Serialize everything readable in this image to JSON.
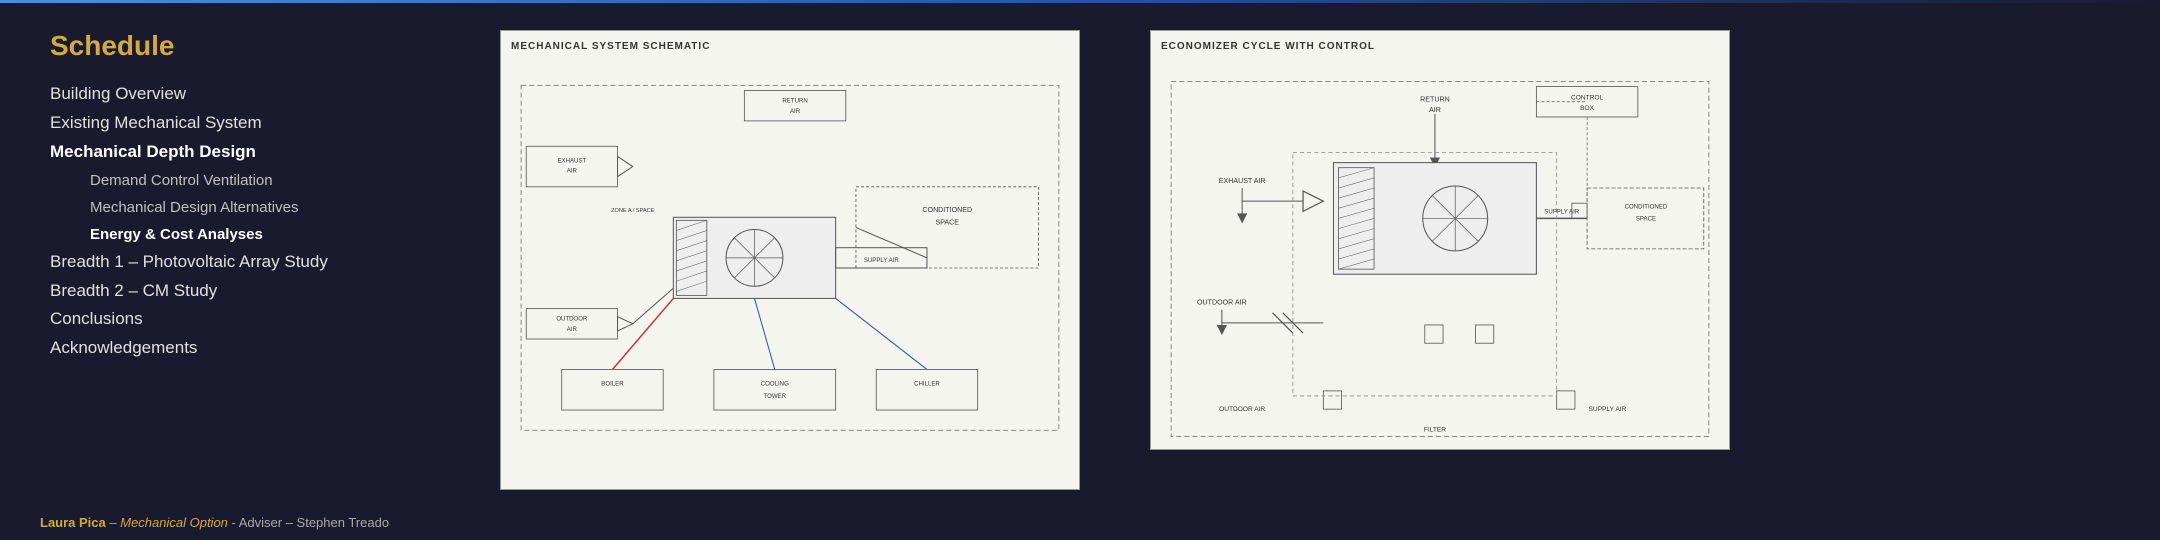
{
  "topLine": true,
  "sidebar": {
    "title": "Schedule",
    "items": [
      {
        "id": "building-overview",
        "label": "Building Overview",
        "level": "top",
        "active": false
      },
      {
        "id": "existing-mechanical",
        "label": "Existing Mechanical System",
        "level": "top",
        "active": false
      },
      {
        "id": "mechanical-depth",
        "label": "Mechanical Depth Design",
        "level": "top",
        "active": true
      },
      {
        "id": "demand-control",
        "label": "Demand Control Ventilation",
        "level": "sub",
        "active": false
      },
      {
        "id": "mechanical-design-alt",
        "label": "Mechanical Design Alternatives",
        "level": "sub",
        "active": false
      },
      {
        "id": "energy-cost",
        "label": "Energy & Cost Analyses",
        "level": "sub",
        "active": true
      },
      {
        "id": "breadth-pv",
        "label": "Breadth 1 – Photovoltaic Array Study",
        "level": "top",
        "active": false
      },
      {
        "id": "breadth-cm",
        "label": "Breadth 2 – CM Study",
        "level": "top",
        "active": false
      },
      {
        "id": "conclusions",
        "label": "Conclusions",
        "level": "top",
        "active": false
      },
      {
        "id": "acknowledgements",
        "label": "Acknowledgements",
        "level": "top",
        "active": false
      }
    ]
  },
  "footer": {
    "name": "Laura Pica",
    "dash": " – ",
    "option_label": "Mechanical Option",
    "adviser_text": " - Adviser – Stephen Treado"
  },
  "centerDiagram": {
    "title": "MECHANICAL SYSTEM SCHEMATIC"
  },
  "rightDiagram": {
    "title": "ECONOMIZER CYCLE WITH CONTROL"
  }
}
